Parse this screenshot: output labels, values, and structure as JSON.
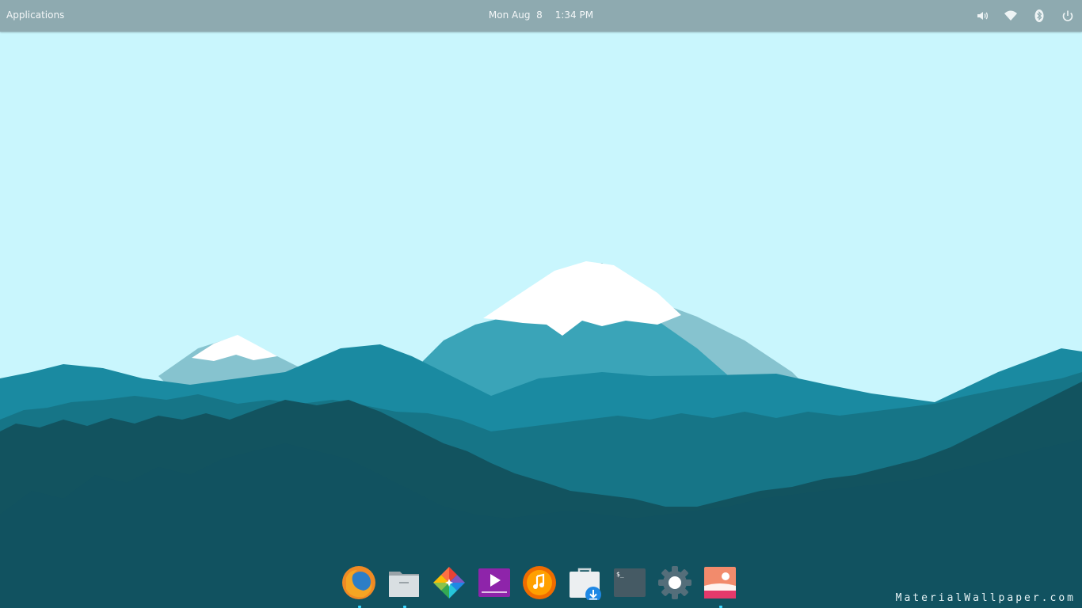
{
  "panel": {
    "applications_label": "Applications",
    "clock_date": "Mon Aug  8",
    "clock_time": "1:34 PM",
    "tray": [
      {
        "name": "volume-icon"
      },
      {
        "name": "wifi-icon"
      },
      {
        "name": "bluetooth-icon"
      },
      {
        "name": "power-icon"
      }
    ]
  },
  "dock": {
    "items": [
      {
        "name": "firefox",
        "running": true
      },
      {
        "name": "files",
        "running": true
      },
      {
        "name": "photos",
        "running": false
      },
      {
        "name": "videos",
        "running": false
      },
      {
        "name": "music",
        "running": false
      },
      {
        "name": "app-center",
        "running": false
      },
      {
        "name": "terminal",
        "running": false,
        "glyph": "$_"
      },
      {
        "name": "settings",
        "running": false
      },
      {
        "name": "wallpaper",
        "running": true
      }
    ]
  },
  "watermark": "MaterialWallpaper.com",
  "colors": {
    "sky": "#c9f6fd",
    "panel": "#8eaab0",
    "forest_dark": "#12535f",
    "accent_dot": "#3ad7ff"
  }
}
